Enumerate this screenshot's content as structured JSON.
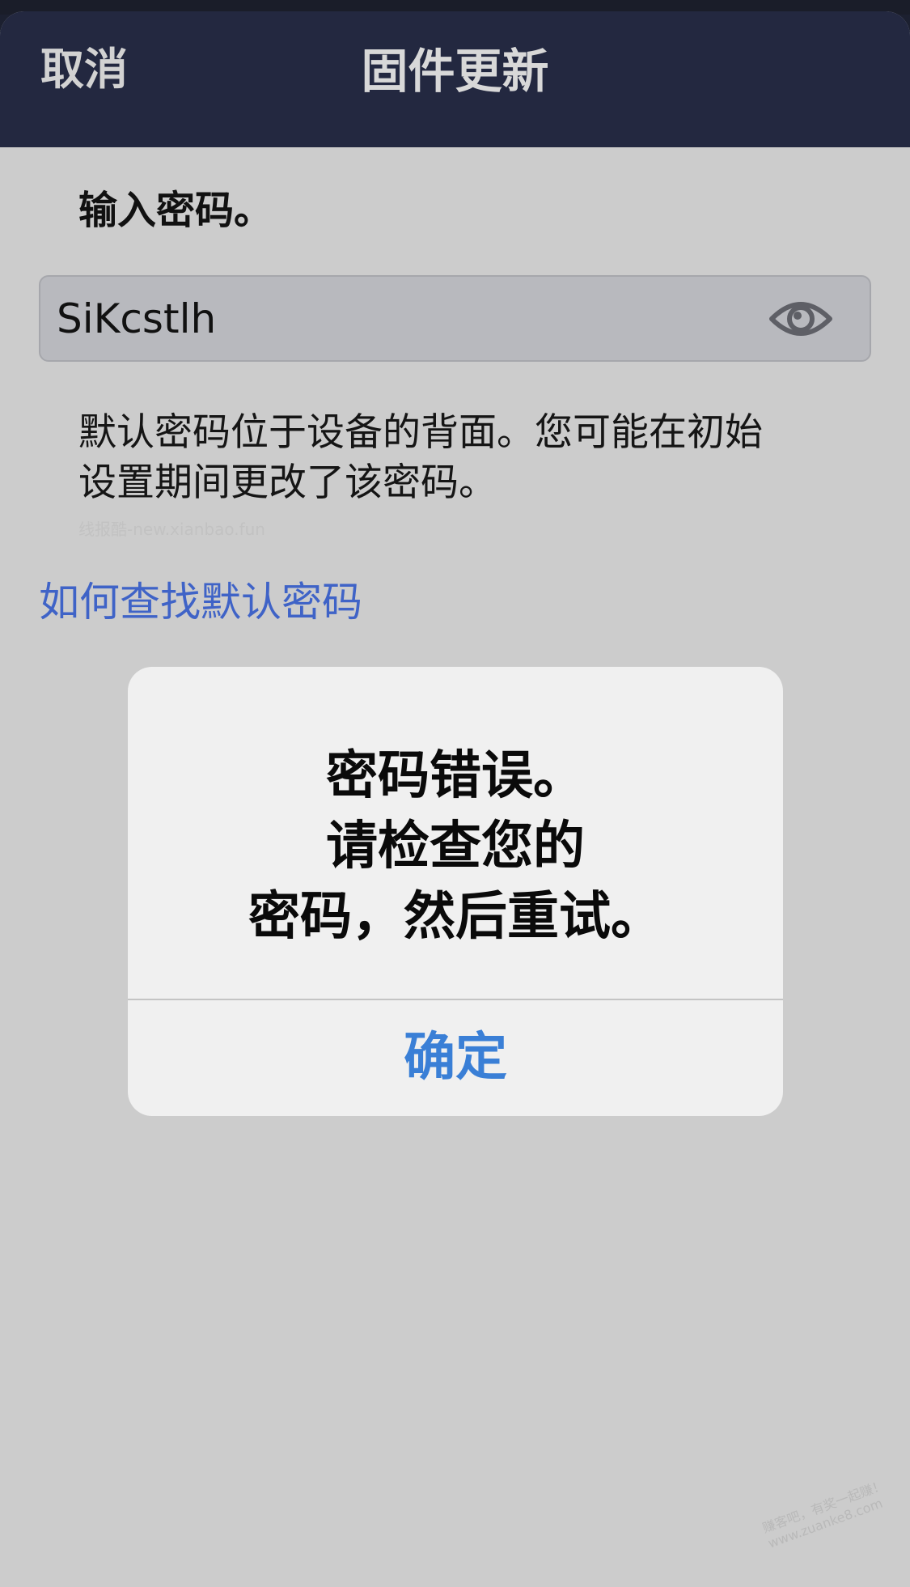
{
  "navbar": {
    "cancel_label": "取消",
    "title": "固件更新"
  },
  "form": {
    "prompt": "输入密码。",
    "password_value": "SiKcstlh",
    "eye_icon": "eye-icon",
    "description_line1": "默认密码位于设备的背面。您可能在初始",
    "description_line2": "设置期间更改了该密码。",
    "help_link": "如何查找默认密码"
  },
  "watermark": {
    "text": "线报酷-new.xianbao.fun"
  },
  "alert": {
    "message_line1": "密码错误。",
    "message_line2": "请检查您的",
    "message_line3": "密码，然后重试。",
    "ok_label": "确定"
  },
  "corner_stamp": {
    "line1": "赚客吧，有奖一起赚！",
    "line2": "www.zuanke8.com"
  },
  "colors": {
    "navbar_bg": "#232840",
    "page_bg": "#cccccc",
    "link": "#3f63c7",
    "alert_button": "#3a7fd6"
  }
}
